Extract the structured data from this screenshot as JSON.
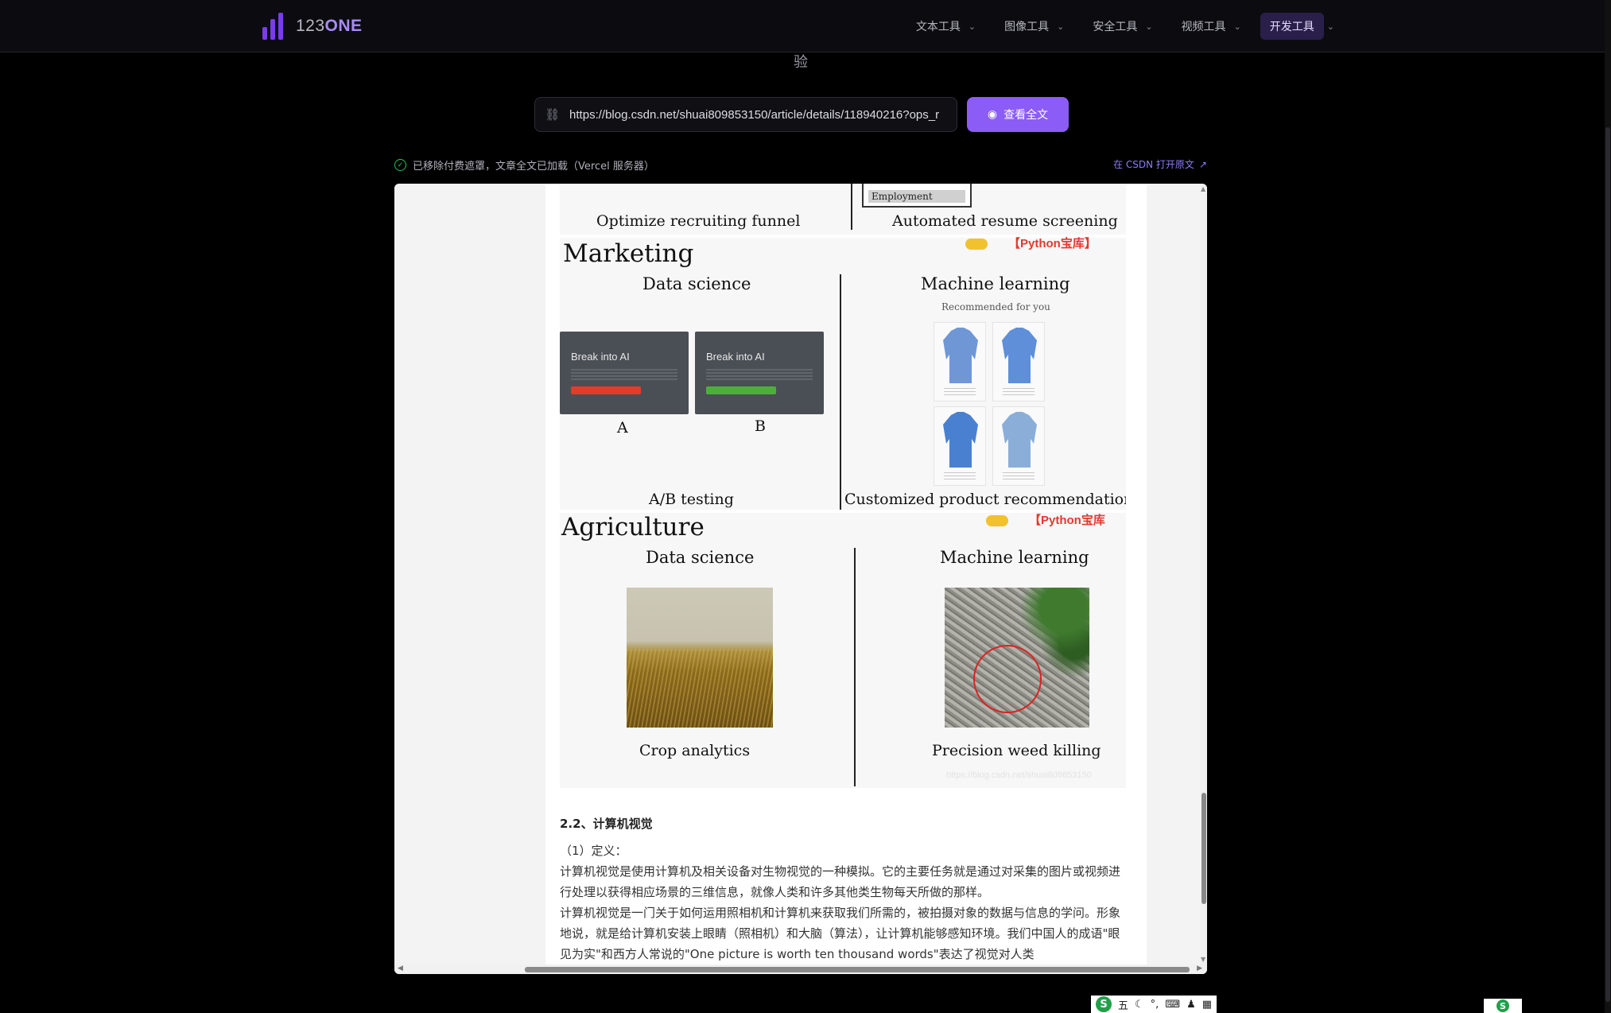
{
  "header": {
    "logo_prefix": "123",
    "logo_suffix": "ONE",
    "nav": [
      {
        "label": "文本工具",
        "active": false
      },
      {
        "label": "图像工具",
        "active": false
      },
      {
        "label": "安全工具",
        "active": false
      },
      {
        "label": "视频工具",
        "active": false
      },
      {
        "label": "开发工具",
        "active": true
      }
    ]
  },
  "stray_char": "验",
  "url_input": {
    "value": "https://blog.csdn.net/shuai809853150/article/details/118940216?ops_r",
    "icon": "link-icon"
  },
  "view_button": {
    "label": "查看全文",
    "icon": "eye-icon"
  },
  "status": {
    "text": "已移除付费遮罩，文章全文已加载（Vercel 服务器）",
    "icon": "check-circle-icon",
    "color": "#22c55e"
  },
  "open_original": {
    "label": "在 CSDN 打开原文",
    "icon": "external-link-icon"
  },
  "article": {
    "top_fig": {
      "left_caption": "Optimize recruiting funnel",
      "right_caption": "Automated resume screening",
      "box_label": "Employment"
    },
    "marketing": {
      "title": "Marketing",
      "left_sub": "Data science",
      "right_sub": "Machine learning",
      "recommended": "Recommended for you",
      "card_a_title": "Break into AI",
      "card_b_title": "Break into AI",
      "label_a": "A",
      "label_b": "B",
      "left_caption": "A/B testing",
      "right_caption": "Customized product recommendation",
      "watermark": "【Python宝库】"
    },
    "agriculture": {
      "title": "Agriculture",
      "left_sub": "Data science",
      "right_sub": "Machine learning",
      "left_caption": "Crop analytics",
      "right_caption": "Precision weed killing",
      "watermark": "【Python宝库",
      "faint_url": "https://blog.csdn.net/shuai809853150"
    },
    "section_heading": "2.2、计算机视觉",
    "paragraphs": [
      "（1）定义：",
      "计算机视觉是使用计算机及相关设备对生物视觉的一种模拟。它的主要任务就是通过对采集的图片或视频进行处理以获得相应场景的三维信息，就像人类和许多其他类生物每天所做的那样。",
      "计算机视觉是一门关于如何运用照相机和计算机来获取我们所需的，被拍摄对象的数据与信息的学问。形象地说，就是给计算机安装上眼睛（照相机）和大脑（算法），让计算机能够感知环境。我们中国人的成语\"眼见为实\"和西方人常说的\"One picture is worth ten thousand words\"表达了视觉对人类"
    ]
  },
  "ime": {
    "logo": "S",
    "mode": "五",
    "icons": [
      "moon-icon",
      "punctuation-icon",
      "keyboard-icon",
      "user-icon",
      "grid-icon"
    ]
  },
  "colors": {
    "accent": "#8b5cf6",
    "accent_dark": "#7c3aed",
    "success": "#22c55e",
    "watermark": "#e23a2e"
  }
}
